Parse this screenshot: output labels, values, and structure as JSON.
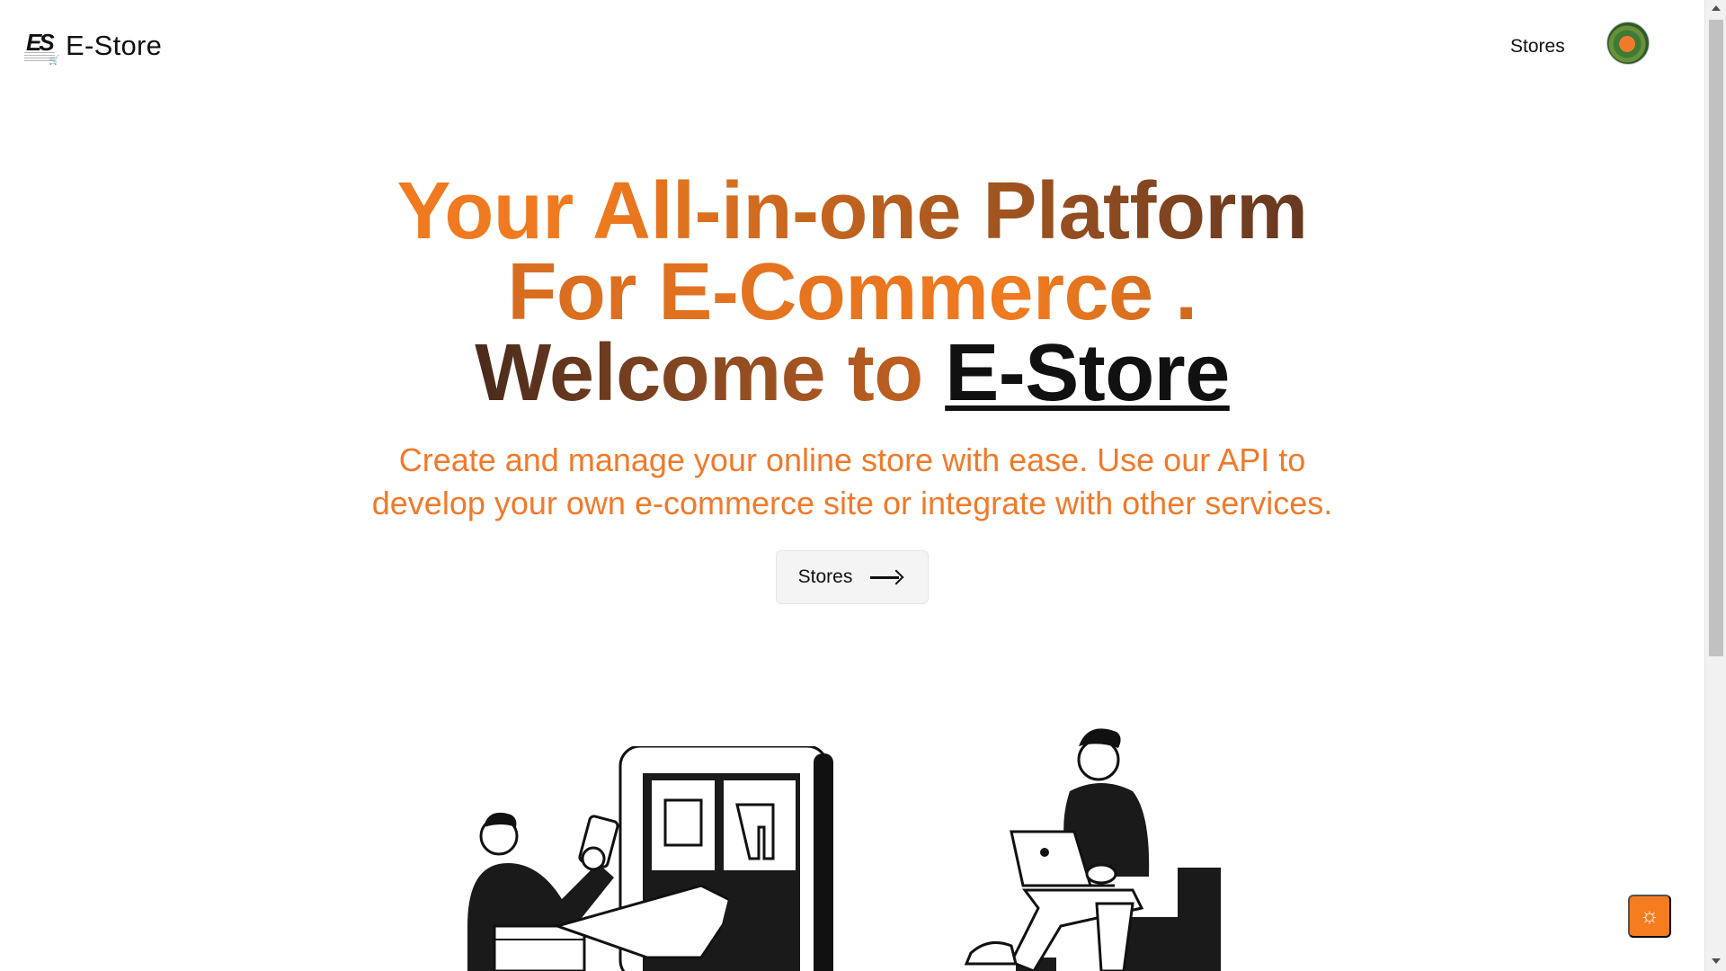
{
  "header": {
    "brand_logo_text": "ES",
    "brand_name": "E-Store",
    "nav_stores": "Stores"
  },
  "hero": {
    "headline_line1": "Your All-in-one Platform",
    "headline_line2": "For E-Commerce .",
    "headline_line3_prefix": "Welcome to ",
    "headline_line3_brand": "E-Store",
    "subtext": "Create and manage your online store with ease. Use our API to develop your own e-commerce site or integrate with other services.",
    "cta_label": "Stores"
  },
  "icons": {
    "cta": "arrow-right-icon",
    "theme_toggle": "sun-icon",
    "avatar": "user-avatar"
  },
  "colors": {
    "accent": "#f57c1f",
    "headline_dark": "#4a2a1c",
    "text": "#111111"
  }
}
